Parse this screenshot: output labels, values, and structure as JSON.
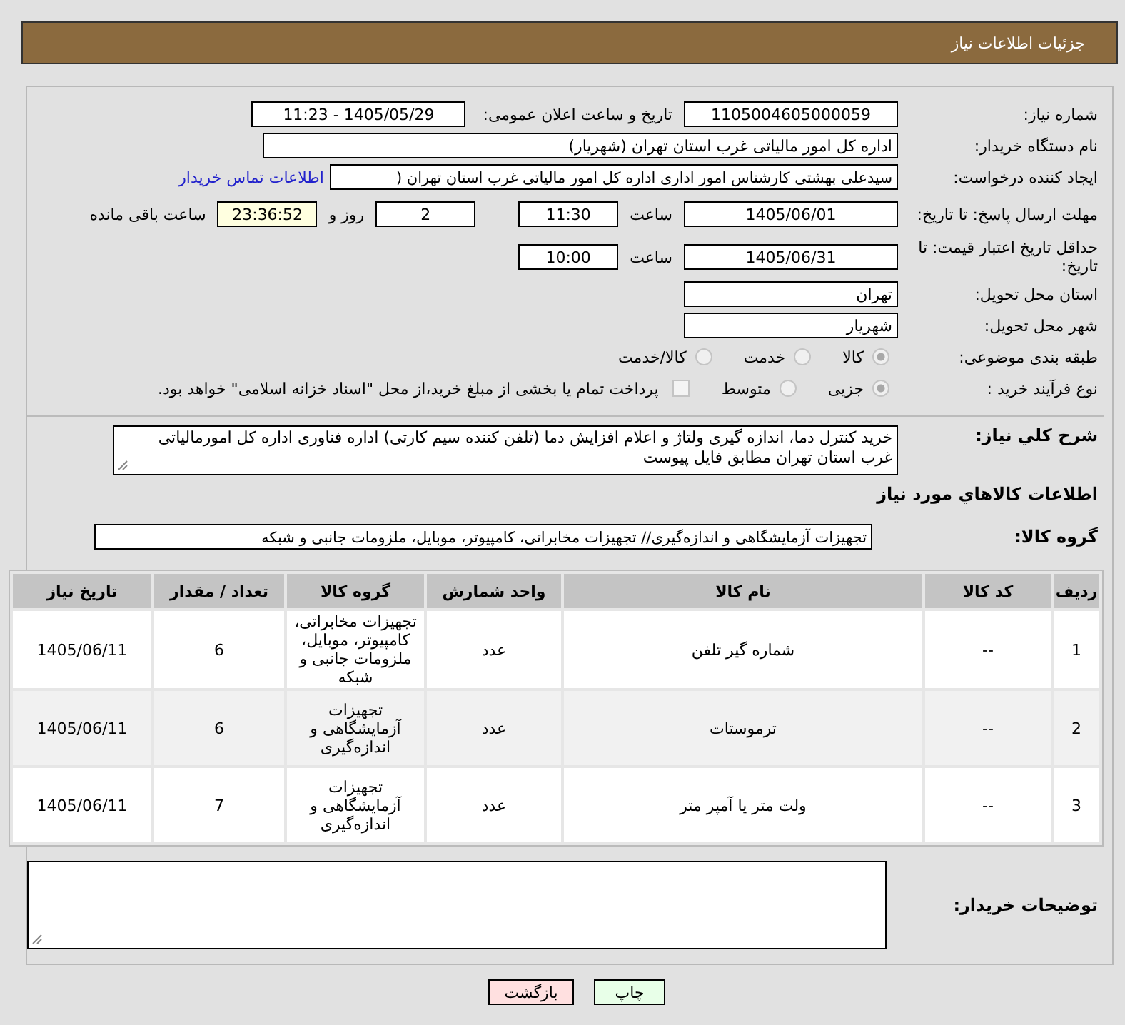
{
  "header": {
    "title": "جزئیات اطلاعات نیاز"
  },
  "need_number": {
    "label": "شماره نیاز:",
    "value": "1105004605000059"
  },
  "announce": {
    "label": "تاریخ و ساعت اعلان عمومی:",
    "value": "1405/05/29 - 11:23"
  },
  "buyer": {
    "label": "نام دستگاه خریدار:",
    "value": "اداره کل امور مالیاتی غرب استان تهران (شهریار)"
  },
  "creator": {
    "label": "ایجاد کننده درخواست:",
    "value": "سیدعلی بهشتی کارشناس امور اداری اداره کل امور مالیاتی غرب استان تهران (",
    "link": "اطلاعات تماس خریدار"
  },
  "deadline": {
    "label": "مهلت ارسال پاسخ: تا تاریخ:",
    "date": "1405/06/01",
    "time_label": "ساعت",
    "time": "11:30",
    "days": "2",
    "days_label": "روز و",
    "remaining": "23:36:52",
    "remaining_label": "ساعت باقی مانده"
  },
  "validity": {
    "label": "حداقل تاریخ اعتبار قیمت: تا تاریخ:",
    "date": "1405/06/31",
    "time_label": "ساعت",
    "time": "10:00"
  },
  "province": {
    "label": "استان محل تحویل:",
    "value": "تهران"
  },
  "city": {
    "label": "شهر محل تحویل:",
    "value": "شهریار"
  },
  "classification": {
    "label": "طبقه بندی موضوعی:",
    "options": [
      {
        "label": "کالا",
        "selected": true
      },
      {
        "label": "خدمت",
        "selected": false
      },
      {
        "label": "کالا/خدمت",
        "selected": false
      }
    ]
  },
  "purchase_type": {
    "label": "نوع فرآیند خرید :",
    "options": [
      {
        "label": "جزیی",
        "selected": true
      },
      {
        "label": "متوسط",
        "selected": false
      }
    ],
    "treasury": {
      "label": "پرداخت تمام یا بخشی از مبلغ خرید،از محل \"اسناد خزانه اسلامی\" خواهد بود.",
      "checked": false
    }
  },
  "description": {
    "label": "شرح کلي نياز:",
    "value": "خرید کنترل دما، اندازه گیری ولتاژ و اعلام افزایش دما (تلفن کننده سیم کارتی) اداره فناوری اداره کل امورمالیاتی غرب استان تهران مطابق فایل پیوست"
  },
  "goods_title": "اطلاعات کالاهاي مورد نياز",
  "goods_group": {
    "label": "گروه کالا:",
    "value": "تجهیزات آزمایشگاهی و اندازه‌گیری// تجهیزات مخابراتی، کامپیوتر، موبایل، ملزومات جانبی و شبکه"
  },
  "table": {
    "columns": [
      "ردیف",
      "کد کالا",
      "نام کالا",
      "واحد شمارش",
      "گروه کالا",
      "تعداد / مقدار",
      "تاریخ نیاز"
    ],
    "rows": [
      [
        "1",
        "--",
        "شماره گیر تلفن",
        "عدد",
        "تجهیزات مخابراتی، کامپیوتر، موبایل، ملزومات جانبی و شبکه",
        "6",
        "1405/06/11"
      ],
      [
        "2",
        "--",
        "ترموستات",
        "عدد",
        "تجهیزات آزمایشگاهی و اندازه‌گیری",
        "6",
        "1405/06/11"
      ],
      [
        "3",
        "--",
        "ولت متر یا آمپر متر",
        "عدد",
        "تجهیزات آزمایشگاهی و اندازه‌گیری",
        "7",
        "1405/06/11"
      ]
    ]
  },
  "buyer_notes": {
    "label": "توضیحات خریدار:"
  },
  "buttons": [
    {
      "label": "چاپ",
      "kind": "print"
    },
    {
      "label": "بازگشت",
      "kind": "back"
    }
  ]
}
